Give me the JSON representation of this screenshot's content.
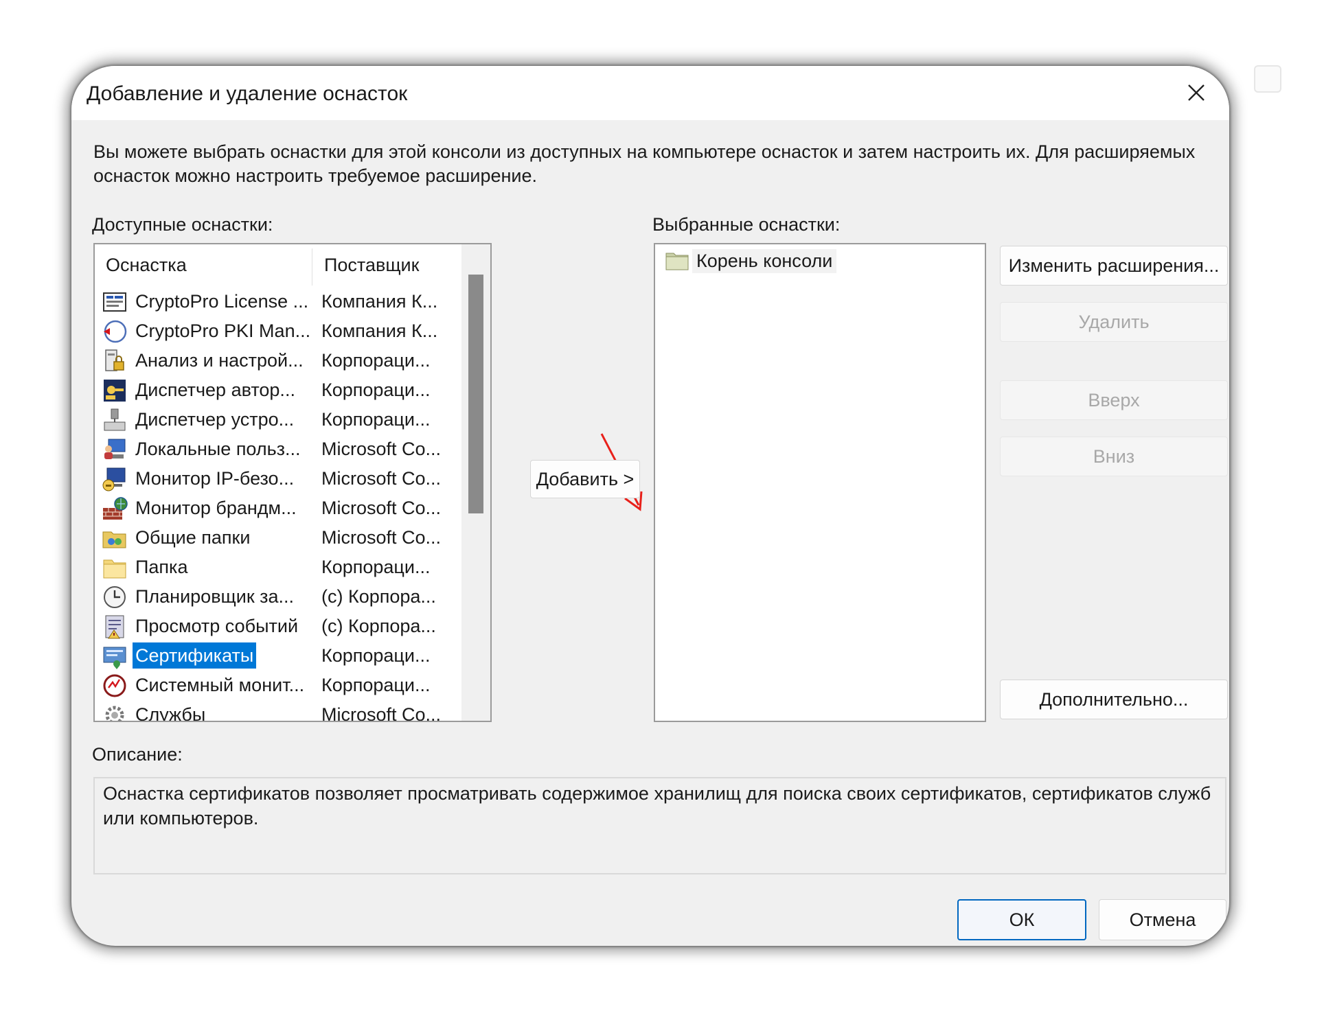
{
  "dialog": {
    "title": "Добавление и удаление оснасток",
    "intro": "Вы можете выбрать оснастки для этой консоли из доступных на компьютере оснасток и затем настроить их. Для расширяемых оснасток можно настроить требуемое расширение."
  },
  "available": {
    "label": "Доступные оснастки:",
    "col_snapin": "Оснастка",
    "col_vendor": "Поставщик",
    "items": [
      {
        "name": "CryptoPro License ...",
        "vendor": "Компания К...",
        "icon": "license-icon"
      },
      {
        "name": "CryptoPro PKI Man...",
        "vendor": "Компания К...",
        "icon": "pki-icon"
      },
      {
        "name": "Анализ и настрой...",
        "vendor": "Корпораци...",
        "icon": "security-config-icon"
      },
      {
        "name": "Диспетчер автор...",
        "vendor": "Корпораци...",
        "icon": "authorization-icon"
      },
      {
        "name": "Диспетчер устро...",
        "vendor": "Корпораци...",
        "icon": "device-manager-icon"
      },
      {
        "name": "Локальные польз...",
        "vendor": "Microsoft Co...",
        "icon": "local-users-icon"
      },
      {
        "name": "Монитор IP-безо...",
        "vendor": "Microsoft Co...",
        "icon": "ipsec-monitor-icon"
      },
      {
        "name": "Монитор брандм...",
        "vendor": "Microsoft Co...",
        "icon": "firewall-icon"
      },
      {
        "name": "Общие папки",
        "vendor": "Microsoft Co...",
        "icon": "shared-folders-icon"
      },
      {
        "name": "Папка",
        "vendor": "Корпораци...",
        "icon": "folder-icon"
      },
      {
        "name": "Планировщик за...",
        "vendor": "(c) Корпора...",
        "icon": "task-scheduler-icon"
      },
      {
        "name": "Просмотр событий",
        "vendor": "(c) Корпора...",
        "icon": "event-viewer-icon"
      },
      {
        "name": "Сертификаты",
        "vendor": "Корпораци...",
        "icon": "certificates-icon",
        "selected": true
      },
      {
        "name": "Системный монит...",
        "vendor": "Корпораци...",
        "icon": "system-monitor-icon"
      },
      {
        "name": "Службы",
        "vendor": "Microsoft Co...",
        "icon": "services-icon"
      }
    ]
  },
  "add_button": "Добавить >",
  "selected": {
    "label": "Выбранные оснастки:",
    "items": [
      {
        "name": "Корень консоли",
        "icon": "folder-icon"
      }
    ]
  },
  "side_buttons": {
    "edit_extensions": "Изменить расширения...",
    "remove": "Удалить",
    "up": "Вверх",
    "down": "Вниз",
    "advanced": "Дополнительно..."
  },
  "description": {
    "label": "Описание:",
    "text": "Оснастка сертификатов позволяет просматривать содержимое хранилищ для поиска своих сертификатов, сертификатов служб или компьютеров."
  },
  "footer": {
    "ok": "ОК",
    "cancel": "Отмена"
  },
  "colors": {
    "selection": "#0078d7",
    "annotation_arrow": "#e8201a",
    "primary_border": "#0067c0"
  }
}
